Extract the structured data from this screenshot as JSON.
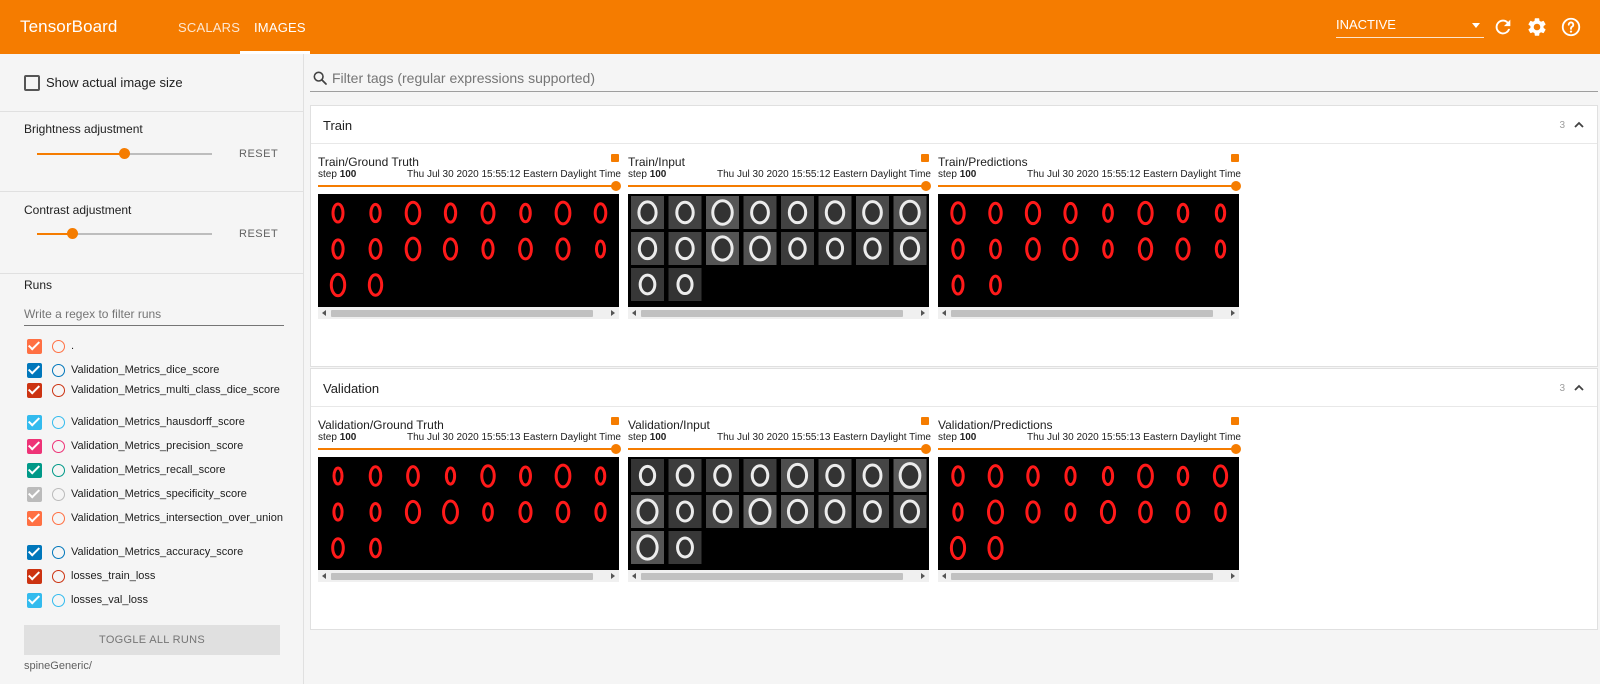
{
  "app": {
    "title": "TensorBoard"
  },
  "tabs": [
    {
      "label": "Scalars",
      "active": false
    },
    {
      "label": "Images",
      "active": true
    }
  ],
  "header": {
    "status_select": "INACTIVE",
    "icons": [
      "refresh-icon",
      "settings-icon",
      "help-icon"
    ]
  },
  "sidebar": {
    "show_actual_size": {
      "label": "Show actual image size",
      "checked": false
    },
    "brightness": {
      "label": "Brightness adjustment",
      "value": 0.5,
      "reset": "RESET"
    },
    "contrast": {
      "label": "Contrast adjustment",
      "value": 0.2,
      "reset": "RESET"
    },
    "runs": {
      "title": "Runs",
      "filter_placeholder": "Write a regex to filter runs",
      "items": [
        {
          "name": ".",
          "color": "#ff7043"
        },
        {
          "name": "Validation_Metrics_dice_score",
          "color": "#0077bb"
        },
        {
          "name": "Validation_Metrics_multi_class_dice_score",
          "color": "#cc3311"
        },
        {
          "name": "Validation_Metrics_hausdorff_score",
          "color": "#33bbee"
        },
        {
          "name": "Validation_Metrics_precision_score",
          "color": "#ee3377"
        },
        {
          "name": "Validation_Metrics_recall_score",
          "color": "#009988"
        },
        {
          "name": "Validation_Metrics_specificity_score",
          "color": "#bbbbbb"
        },
        {
          "name": "Validation_Metrics_intersection_over_union",
          "color": "#ff7043"
        },
        {
          "name": "Validation_Metrics_accuracy_score",
          "color": "#0077bb"
        },
        {
          "name": "losses_train_loss",
          "color": "#cc3311"
        },
        {
          "name": "losses_val_loss",
          "color": "#33bbee"
        }
      ],
      "toggle_all": "TOGGLE ALL RUNS",
      "logdir": "spineGeneric/"
    }
  },
  "main": {
    "filter_placeholder": "Filter tags (regular expressions supported)",
    "cards": [
      {
        "title": "Train",
        "count": "3",
        "panels": [
          {
            "tag": "Train/Ground Truth",
            "step_label": "step",
            "step": "100",
            "time": "Thu Jul 30 2020 15:55:12 Eastern Daylight Time",
            "kind": "mask"
          },
          {
            "tag": "Train/Input",
            "step_label": "step",
            "step": "100",
            "time": "Thu Jul 30 2020 15:55:12 Eastern Daylight Time",
            "kind": "input"
          },
          {
            "tag": "Train/Predictions",
            "step_label": "step",
            "step": "100",
            "time": "Thu Jul 30 2020 15:55:12 Eastern Daylight Time",
            "kind": "mask"
          }
        ]
      },
      {
        "title": "Validation",
        "count": "3",
        "panels": [
          {
            "tag": "Validation/Ground Truth",
            "step_label": "step",
            "step": "100",
            "time": "Thu Jul 30 2020 15:55:13 Eastern Daylight Time",
            "kind": "mask"
          },
          {
            "tag": "Validation/Input",
            "step_label": "step",
            "step": "100",
            "time": "Thu Jul 30 2020 15:55:13 Eastern Daylight Time",
            "kind": "input"
          },
          {
            "tag": "Validation/Predictions",
            "step_label": "step",
            "step": "100",
            "time": "Thu Jul 30 2020 15:55:13 Eastern Daylight Time",
            "kind": "mask"
          }
        ]
      }
    ]
  },
  "colors": {
    "accent": "#f57c00",
    "mask": "#ff1a1a"
  }
}
